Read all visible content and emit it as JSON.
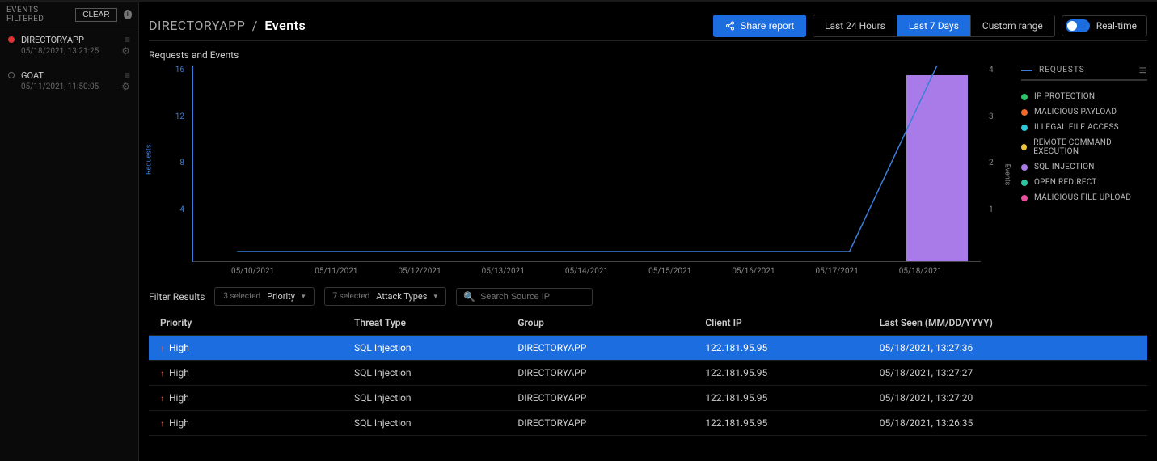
{
  "sidebar": {
    "filter_label": "EVENTS FILTERED",
    "clear_label": "CLEAR",
    "groups": [
      {
        "status": "red",
        "name": "DIRECTORYAPP",
        "ts": "05/18/2021, 13:21:25"
      },
      {
        "status": "grey",
        "name": "GOAT",
        "ts": "05/11/2021, 11:50:05"
      }
    ]
  },
  "breadcrumb": {
    "prefix": "DIRECTORYAPP",
    "slash": "/",
    "current": "Events"
  },
  "header": {
    "share_label": "Share report",
    "ranges": [
      "Last 24 Hours",
      "Last 7 Days",
      "Custom range"
    ],
    "active_range_index": 1,
    "realtime_label": "Real-time",
    "realtime_on": false
  },
  "section_title": "Requests and Events",
  "chart_data": {
    "type": "bar+line",
    "xlabel": "",
    "y_left_label": "Requests",
    "y_right_label": "Events",
    "y_left_ticks": [
      16,
      12,
      8,
      4
    ],
    "y_right_ticks": [
      4,
      3,
      2,
      1
    ],
    "categories": [
      "05/10/2021",
      "05/11/2021",
      "05/12/2021",
      "05/13/2021",
      "05/14/2021",
      "05/15/2021",
      "05/16/2021",
      "05/17/2021",
      "05/18/2021"
    ],
    "series": [
      {
        "name": "Requests",
        "axis": "left",
        "kind": "line",
        "color": "#3b7dd8",
        "values": [
          0,
          0,
          0,
          0,
          0,
          0,
          0,
          0,
          16
        ]
      },
      {
        "name": "SQL Injection",
        "axis": "right",
        "kind": "bar",
        "color": "#a97be8",
        "values": [
          0,
          0,
          0,
          0,
          0,
          0,
          0,
          0,
          4
        ]
      }
    ],
    "ylim_left": [
      0,
      16
    ],
    "ylim_right": [
      0,
      4
    ]
  },
  "legend": {
    "title": "REQUESTS",
    "items": [
      {
        "color": "#29c46c",
        "label": "IP PROTECTION"
      },
      {
        "color": "#f06b2b",
        "label": "MALICIOUS PAYLOAD"
      },
      {
        "color": "#2cc6d6",
        "label": "ILLEGAL FILE ACCESS"
      },
      {
        "color": "#e8c23a",
        "label": "REMOTE COMMAND EXECUTION"
      },
      {
        "color": "#a97be8",
        "label": "SQL INJECTION"
      },
      {
        "color": "#29c4a0",
        "label": "OPEN REDIRECT"
      },
      {
        "color": "#e84e9a",
        "label": "MALICIOUS FILE UPLOAD"
      }
    ]
  },
  "filters": {
    "label": "Filter Results",
    "priority": {
      "selected_count": "3 selected",
      "label": "Priority"
    },
    "attack": {
      "selected_count": "7 selected",
      "label": "Attack Types"
    },
    "search_placeholder": "Search Source IP"
  },
  "table": {
    "columns": [
      "Priority",
      "Threat Type",
      "Group",
      "Client IP",
      "Last Seen (MM/DD/YYYY)"
    ],
    "rows": [
      {
        "priority": "High",
        "threat": "SQL Injection",
        "group": "DIRECTORYAPP",
        "ip": "122.181.95.95",
        "last": "05/18/2021, 13:27:36",
        "selected": true
      },
      {
        "priority": "High",
        "threat": "SQL Injection",
        "group": "DIRECTORYAPP",
        "ip": "122.181.95.95",
        "last": "05/18/2021, 13:27:27",
        "selected": false
      },
      {
        "priority": "High",
        "threat": "SQL Injection",
        "group": "DIRECTORYAPP",
        "ip": "122.181.95.95",
        "last": "05/18/2021, 13:27:20",
        "selected": false
      },
      {
        "priority": "High",
        "threat": "SQL Injection",
        "group": "DIRECTORYAPP",
        "ip": "122.181.95.95",
        "last": "05/18/2021, 13:26:35",
        "selected": false
      }
    ]
  }
}
